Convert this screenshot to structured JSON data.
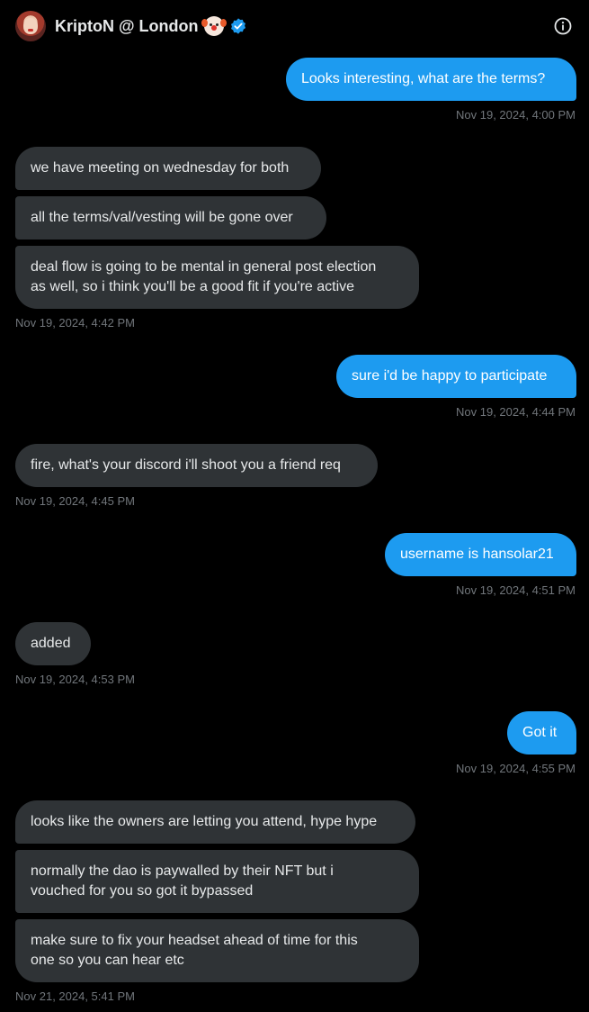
{
  "header": {
    "title": "KriptoN @ London",
    "icons": [
      "avatar",
      "clown-face-icon",
      "verified-badge-icon",
      "info-icon"
    ],
    "accent_color": "#1d9bf0"
  },
  "messages": [
    {
      "direction": "out",
      "text": "Looks interesting, what are the terms?"
    },
    {
      "direction": "out_ts",
      "text": "Nov 19, 2024, 4:00 PM"
    },
    {
      "direction": "in",
      "text": "we have meeting on wednesday for both"
    },
    {
      "direction": "in",
      "text": "all the terms/val/vesting will be gone over"
    },
    {
      "direction": "in",
      "text": "deal flow is going to be mental in general post election\nas well, so i think you'll be a good fit if you're active"
    },
    {
      "direction": "in_ts",
      "text": "Nov 19, 2024, 4:42 PM"
    },
    {
      "direction": "out",
      "text": "sure i'd be happy to participate"
    },
    {
      "direction": "out_ts",
      "text": "Nov 19, 2024, 4:44 PM"
    },
    {
      "direction": "in",
      "text": "fire, what's your discord i'll shoot you a friend req"
    },
    {
      "direction": "in_ts",
      "text": "Nov 19, 2024, 4:45 PM"
    },
    {
      "direction": "out",
      "text": "username is hansolar21"
    },
    {
      "direction": "out_ts",
      "text": "Nov 19, 2024, 4:51 PM"
    },
    {
      "direction": "in",
      "text": "added"
    },
    {
      "direction": "in_ts",
      "text": "Nov 19, 2024, 4:53 PM"
    },
    {
      "direction": "out",
      "text": "Got it"
    },
    {
      "direction": "out_ts",
      "text": "Nov 19, 2024, 4:55 PM"
    },
    {
      "direction": "in",
      "text": "looks like the owners are letting you attend, hype hype"
    },
    {
      "direction": "in",
      "text": "normally the dao is paywalled by their NFT but i\nvouched for you so got it bypassed"
    },
    {
      "direction": "in",
      "text": "make sure to fix your headset ahead of time for this\none so you can hear etc"
    },
    {
      "direction": "in_ts",
      "text": "Nov 21, 2024, 5:41 PM"
    }
  ]
}
